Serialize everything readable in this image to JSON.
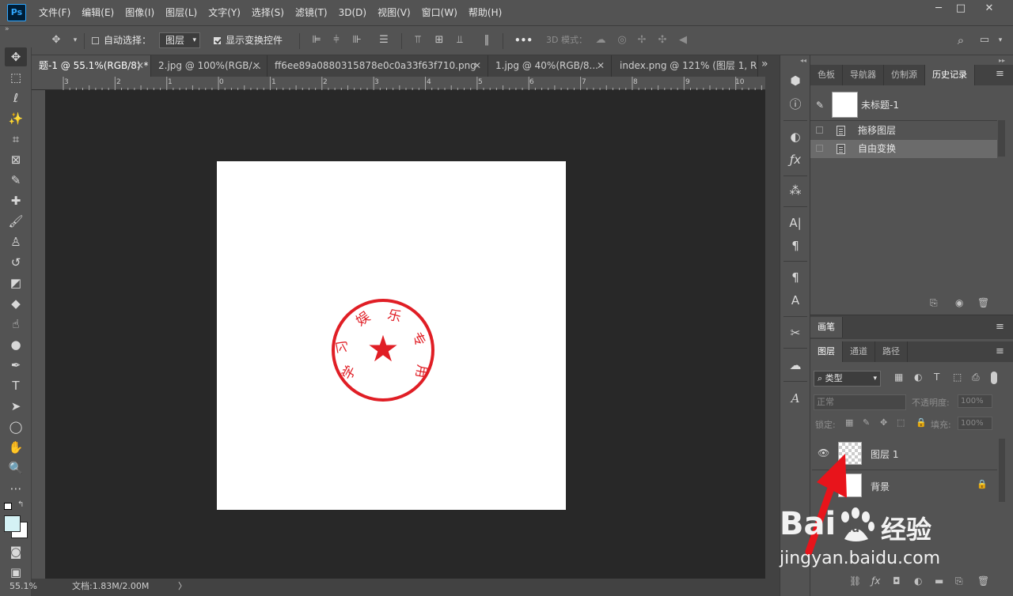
{
  "app": {
    "logo": "Ps"
  },
  "menu": [
    "文件(F)",
    "编辑(E)",
    "图像(I)",
    "图层(L)",
    "文字(Y)",
    "选择(S)",
    "滤镜(T)",
    "3D(D)",
    "视图(V)",
    "窗口(W)",
    "帮助(H)"
  ],
  "window_controls": {
    "minimize": "─",
    "maximize": "□",
    "close": "✕"
  },
  "options": {
    "auto_select_label": "自动选择：",
    "auto_select_value": "图层",
    "show_transform_label": "显示变换控件",
    "more": "•••",
    "mode_3d": "3D 模式："
  },
  "tabs": [
    {
      "label": "题-1 @ 55.1%(RGB/8) *",
      "active": true
    },
    {
      "label": "2.jpg @ 100%(RGB/...",
      "active": false
    },
    {
      "label": "ff6ee89a0880315878e0c0a33f63f710.png",
      "active": false
    },
    {
      "label": "1.jpg @ 40%(RGB/8...",
      "active": false
    },
    {
      "label": "index.png @ 121% (图层 1, R",
      "active": false
    }
  ],
  "tab_close": "✕",
  "tabs_overflow": "»",
  "ruler_labels": [
    "3",
    "2",
    "1",
    "0",
    "1",
    "2",
    "3",
    "4",
    "5",
    "6",
    "7",
    "8",
    "9",
    "10"
  ],
  "status": {
    "zoom": "55.1%",
    "doc": "文档:1.83M/2.00M",
    "arrow": "〉"
  },
  "stamp": {
    "chars": [
      "学",
      "习",
      "娱",
      "乐",
      "专",
      "用"
    ],
    "color": "#e01e25",
    "star": "★"
  },
  "panels": {
    "top_tabs": [
      "色板",
      "导航器",
      "仿制源",
      "历史记录"
    ],
    "top_active": "历史记录",
    "history_snapshot": "未标题-1",
    "history": [
      {
        "label": "拖移图层",
        "selected": false
      },
      {
        "label": "自由变换",
        "selected": true
      }
    ],
    "brush_tab": "画笔",
    "layer_tabs": [
      "图层",
      "通道",
      "路径"
    ],
    "layer_active": "图层",
    "filter_type": "类型",
    "blend_mode": "正常",
    "opacity_label": "不透明度:",
    "opacity_value": "100%",
    "lock_label": "锁定:",
    "fill_label": "填充:",
    "fill_value": "100%",
    "layers": [
      {
        "name": "图层 1",
        "visible": true,
        "transparent": true
      },
      {
        "name": "背景",
        "visible": false,
        "locked": true
      }
    ]
  },
  "watermark": {
    "brand": "Bai",
    "paw": "du",
    "jingyan": "经验",
    "url": "jingyan.baidu.com"
  },
  "colors": {
    "accent": "#31a8ff",
    "arrow": "#e8141b",
    "fg_swatch": "#d4f2f5",
    "bg_swatch": "#ffffff"
  }
}
